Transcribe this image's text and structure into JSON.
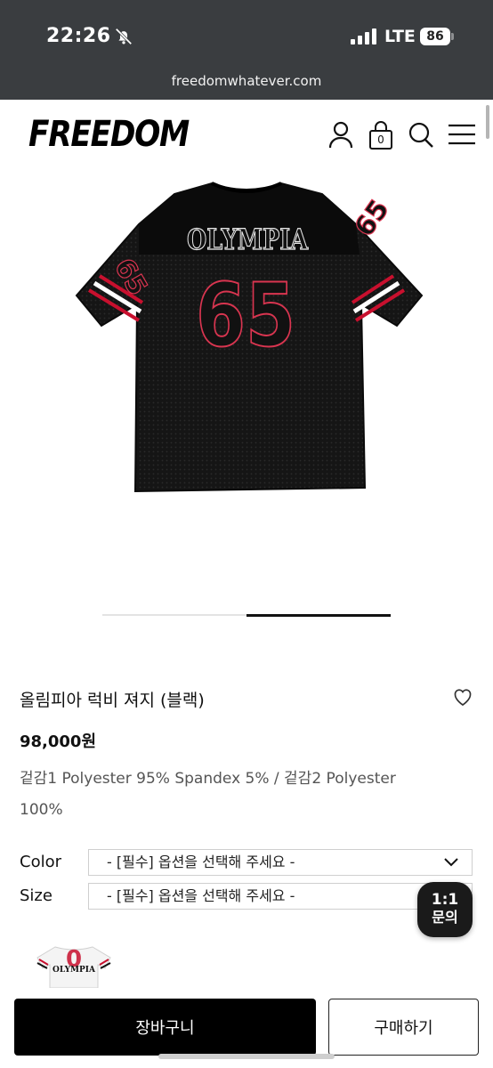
{
  "status_bar": {
    "time": "22:26",
    "network": "LTE",
    "battery": "86"
  },
  "browser": {
    "url": "freedomwhatever.com"
  },
  "site": {
    "logo": "FREEDOM",
    "cart_count": "0"
  },
  "product_image": {
    "front_text": "OLYMPIA",
    "number": "65"
  },
  "thumbnail": {
    "text": "OLYMPIA"
  },
  "product": {
    "name": "올림피아 럭비 져지 (블랙)",
    "price": "98,000원",
    "material": "겉감1 Polyester 95% Spandex 5% / 겉감2 Polyester 100%"
  },
  "options": {
    "color_label": "Color",
    "color_value": "- [필수] 옵션을 선택해 주세요 -",
    "size_label": "Size",
    "size_value": "- [필수] 옵션을 선택해 주세요 -"
  },
  "chat": {
    "line1": "1:1",
    "line2": "문의"
  },
  "actions": {
    "cart": "장바구니",
    "buy": "구매하기"
  },
  "colors": {
    "jersey": "#141414",
    "stripe_red": "#c8102e",
    "stripe_white": "#ffffff",
    "button_dark": "#000000",
    "topbar": "#3a3d40"
  },
  "icons": [
    "bell-slash-icon",
    "signal-icon",
    "battery-icon",
    "user-icon",
    "bag-icon",
    "search-icon",
    "menu-icon",
    "heart-icon",
    "chevron-down-icon"
  ]
}
